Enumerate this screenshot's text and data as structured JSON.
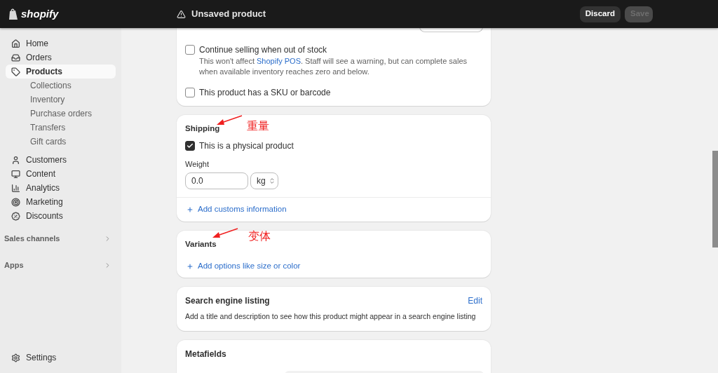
{
  "topbar": {
    "logo": "shopify",
    "title": "Unsaved product",
    "buttons": [
      {
        "label": "Discard",
        "disabled": false
      },
      {
        "label": "Save",
        "disabled": true
      }
    ]
  },
  "sidebar": {
    "items": [
      {
        "label": "Home",
        "selected": false
      },
      {
        "label": "Orders",
        "selected": false
      },
      {
        "label": "Products",
        "selected": true,
        "children": [
          {
            "label": "Collections",
            "selected": false
          },
          {
            "label": "Inventory",
            "selected": false
          },
          {
            "label": "Purchase orders",
            "selected": false
          },
          {
            "label": "Transfers",
            "selected": false
          },
          {
            "label": "Gift cards",
            "selected": false
          }
        ]
      },
      {
        "label": "Customers",
        "selected": false
      },
      {
        "label": "Content",
        "selected": false
      },
      {
        "label": "Analytics",
        "selected": false
      },
      {
        "label": "Marketing",
        "selected": false
      },
      {
        "label": "Discounts",
        "selected": false
      }
    ],
    "sections": [
      {
        "label": "Sales channels"
      },
      {
        "label": "Apps"
      }
    ],
    "footer": {
      "label": "Settings"
    }
  },
  "inventory": {
    "options": [
      {
        "label": "Continue selling when out of stock",
        "checked": false,
        "help_before": "This won't affect ",
        "help_link": "Shopify POS",
        "help_after": ". Staff will see a warning, but can complete sales when available inventory reaches zero and below."
      },
      {
        "label": "This product has a SKU or barcode",
        "checked": false
      }
    ]
  },
  "shipping": {
    "title": "Shipping",
    "physical": {
      "label": "This is a physical product",
      "checked": true
    },
    "weight": {
      "label": "Weight",
      "value": "0.0",
      "unit": "kg"
    },
    "link": "Add customs information"
  },
  "variants": {
    "title": "Variants",
    "link": "Add options like size or color"
  },
  "seo": {
    "title": "Search engine listing",
    "action": "Edit",
    "description": "Add a title and description to see how this product might appear in a search engine listing"
  },
  "metafields": {
    "title": "Metafields"
  },
  "annotations": [
    {
      "text": "重量"
    },
    {
      "text": "变体"
    }
  ]
}
